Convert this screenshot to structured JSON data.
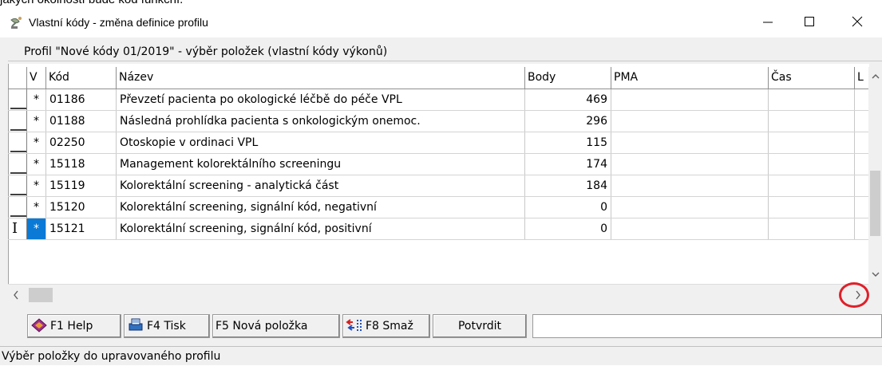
{
  "top_text": "jakých okolností bude kód funkční.",
  "window": {
    "title": "Vlastní kódy - změna definice profilu",
    "app_icon": "satellite-dish-icon",
    "controls": [
      "minimize-icon",
      "maximize-icon",
      "close-icon"
    ]
  },
  "group": {
    "caption": "Profil \"Nové kódy 01/2019\" - výběr položek (vlastní kódy výkonů)"
  },
  "table": {
    "columns": [
      "V",
      "Kód",
      "Název",
      "Body",
      "PMA",
      "Čas",
      "L"
    ],
    "rows": [
      {
        "v": "*",
        "kod": "01186",
        "nazev": "Převzetí pacienta po okologické léčbě do péče VPL",
        "body": "469",
        "pma": "",
        "cas": ""
      },
      {
        "v": "*",
        "kod": "01188",
        "nazev": "Následná prohlídka pacienta s onkologickým onemoc.",
        "body": "296",
        "pma": "",
        "cas": ""
      },
      {
        "v": "*",
        "kod": "02250",
        "nazev": "Otoskopie v ordinaci VPL",
        "body": "115",
        "pma": "",
        "cas": ""
      },
      {
        "v": "*",
        "kod": "15118",
        "nazev": "Management kolorektálního screeningu",
        "body": "174",
        "pma": "",
        "cas": ""
      },
      {
        "v": "*",
        "kod": "15119",
        "nazev": "Kolorektální screening - analytická část",
        "body": "184",
        "pma": "",
        "cas": ""
      },
      {
        "v": "*",
        "kod": "15120",
        "nazev": "Kolorektální screening, signální kód, negativní",
        "body": "0",
        "pma": "",
        "cas": ""
      },
      {
        "v": "*",
        "kod": "15121",
        "nazev": "Kolorektální screening, signální kód, positivní",
        "body": "0",
        "pma": "",
        "cas": ""
      }
    ],
    "selected_row_index": 6,
    "current_row_marker": "I"
  },
  "toolbar": {
    "help_label": "F1 Help",
    "print_label": "F4 Tisk",
    "new_label": "F5 Nová položka",
    "delete_label": "F8 Smaž",
    "confirm_label": "Potvrdit"
  },
  "status": "Výběr položky do upravovaného profilu",
  "colors": {
    "selection": "#0a7ad6",
    "annotation_circle": "#e0202a"
  }
}
